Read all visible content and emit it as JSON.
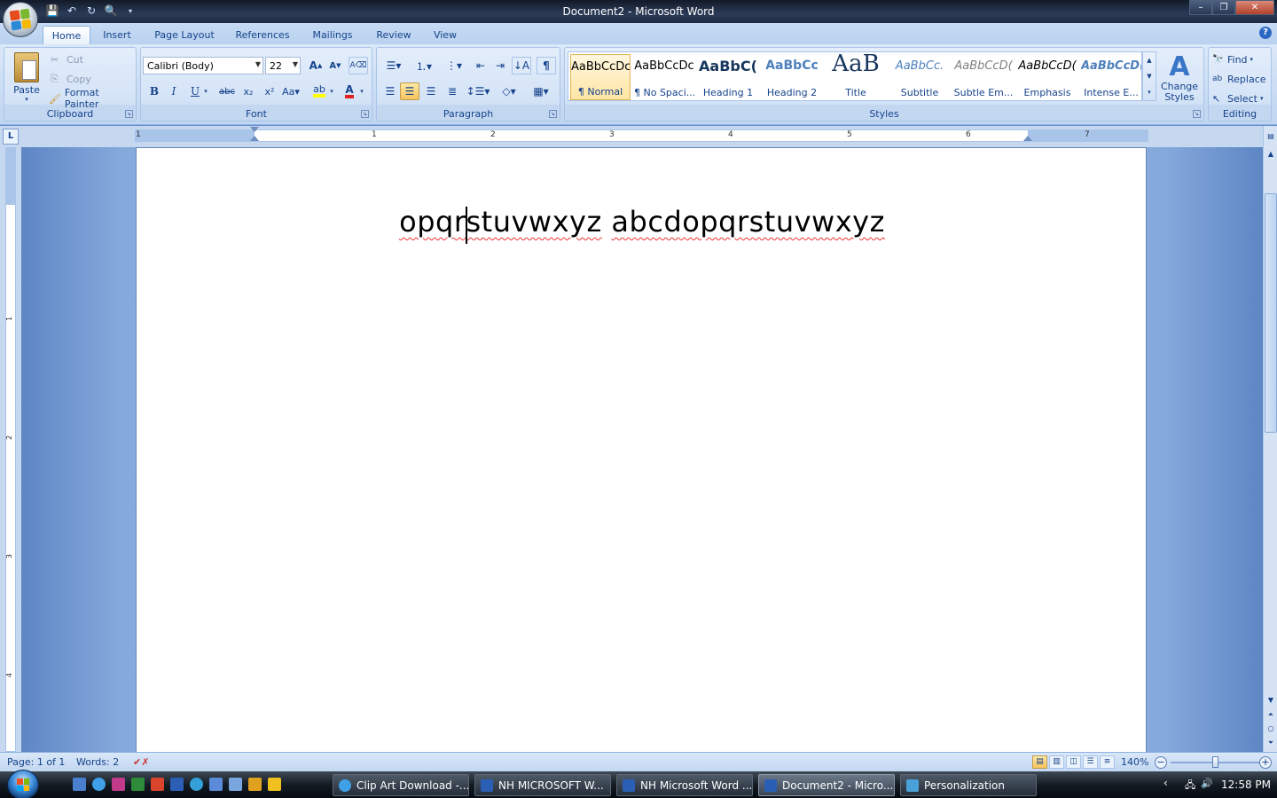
{
  "window": {
    "title": "Document2 - Microsoft Word"
  },
  "tabs": [
    {
      "label": "Home",
      "active": true
    },
    {
      "label": "Insert"
    },
    {
      "label": "Page Layout"
    },
    {
      "label": "References"
    },
    {
      "label": "Mailings"
    },
    {
      "label": "Review"
    },
    {
      "label": "View"
    }
  ],
  "clipboard": {
    "paste_label": "Paste",
    "cut_label": "Cut",
    "copy_label": "Copy",
    "format_painter_label": "Format Painter",
    "group_label": "Clipboard"
  },
  "font": {
    "name": "Calibri (Body)",
    "size": "22",
    "group_label": "Font",
    "font_color": "#e02020",
    "highlight_color": "#ffff00"
  },
  "paragraph": {
    "group_label": "Paragraph"
  },
  "styles": {
    "group_label": "Styles",
    "items": [
      {
        "sample": "AaBbCcDc",
        "label": "¶ Normal"
      },
      {
        "sample": "AaBbCcDc",
        "label": "¶ No Spaci..."
      },
      {
        "sample": "AaBbC(",
        "label": "Heading 1"
      },
      {
        "sample": "AaBbCc",
        "label": "Heading 2"
      },
      {
        "sample": "AaB",
        "label": "Title"
      },
      {
        "sample": "AaBbCc.",
        "label": "Subtitle"
      },
      {
        "sample": "AaBbCcD(",
        "label": "Subtle Em..."
      },
      {
        "sample": "AaBbCcD(",
        "label": "Emphasis"
      },
      {
        "sample": "AaBbCcD(",
        "label": "Intense E..."
      }
    ],
    "change_styles_label": "Change Styles"
  },
  "editing": {
    "group_label": "Editing",
    "find_label": "Find",
    "replace_label": "Replace",
    "select_label": "Select"
  },
  "ruler": {
    "corner_label": "L",
    "numbers": [
      "1",
      "1",
      "2",
      "3",
      "4",
      "5",
      "6",
      "7"
    ],
    "vnumbers": [
      "1",
      "2",
      "3",
      "4"
    ]
  },
  "document": {
    "text_part1": "opqr",
    "text_part2": "stuvwxyz",
    "text_part3": "abcdopqrstuvwxyz"
  },
  "status": {
    "page": "Page: 1 of 1",
    "words": "Words: 2",
    "zoom": "140%"
  },
  "taskbar": {
    "tasks": [
      {
        "label": "Clip Art Download -..."
      },
      {
        "label": "NH MICROSOFT W..."
      },
      {
        "label": "NH Microsoft Word ..."
      },
      {
        "label": "Document2 - Micro...",
        "active": true
      },
      {
        "label": "Personalization"
      }
    ],
    "clock": "12:58 PM"
  }
}
